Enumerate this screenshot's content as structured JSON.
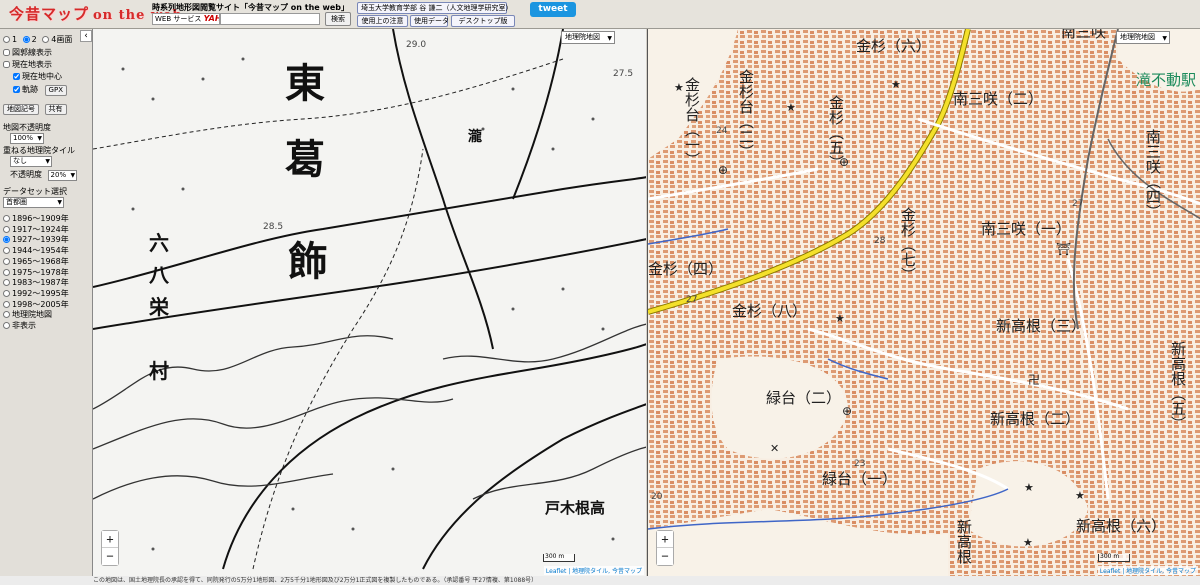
{
  "header": {
    "logo_main": "今昔マップ",
    "logo_sub": "on the web",
    "site_title": "時系列地形図閲覧サイト「今昔マップ on the web」",
    "search_badge_prefix": "WEB サービス",
    "search_badge_brand": "YAHOO!",
    "search_button": "検索",
    "author": "埼玉大学教育学部 谷 謙二（人文地理学研究室）",
    "notes_button": "使用上の注意",
    "data_button": "使用データ",
    "desktop_button": "デスクトップ版",
    "tweet_button": "tweet"
  },
  "sidebar": {
    "toggle": "‹",
    "screens": [
      "1",
      "2",
      "4画面"
    ],
    "screens_selected": 1,
    "boundary_label": "図郭線表示",
    "current_location_label": "現在地表示",
    "current_center_label": "現在地中心",
    "track_label": "軌跡",
    "gpx_button": "GPX",
    "map_symbols_button": "地図記号",
    "share_button": "共有",
    "opacity_label": "地図不透明度",
    "opacity_value": "100%",
    "overlay_label": "重ねる地理院タイル",
    "overlay_value": "なし",
    "overlay_opacity_label": "不透明度",
    "overlay_opacity_value": "20%",
    "dataset_label": "データセット選択",
    "dataset_value": "首都圏",
    "periods": [
      "1896～1909年",
      "1917～1924年",
      "1927～1939年",
      "1944～1954年",
      "1965～1968年",
      "1975～1978年",
      "1983～1987年",
      "1992～1995年",
      "1998～2005年",
      "地理院地図",
      "非表示"
    ],
    "period_selected": 2
  },
  "map_left": {
    "layer_select": "地理院地図",
    "labels": [
      "東",
      "葛",
      "飾",
      "六",
      "八",
      "栄",
      "村",
      "瀧",
      "戸木根高"
    ],
    "numbers": [
      "29.0",
      "27.5",
      "28.5"
    ],
    "scale": "300 m",
    "attribution": "Leaflet | 地理院タイル, 今昔マップ"
  },
  "map_right": {
    "layer_select": "地理院地図",
    "labels": {
      "kanasugi6": "金杉（六）",
      "kanasugidai1": "金杉台（一）",
      "kanasugidai2": "金杉台（二）",
      "kanasugi5": "金杉（五）",
      "kanasugi7": "金杉（七）",
      "kanasugi4": "金杉（四）",
      "kanasugi8": "金杉（八）",
      "minamisansaki2": "南三咲（二）",
      "minamisansaki1": "南三咲（一）",
      "minamisansaki4": "南三咲（四）",
      "minamisansaki_top": "南三咲",
      "takifudo": "滝不動駅",
      "shintakane3": "新高根（三）",
      "shintakane2": "新高根（二）",
      "shintakane5": "新高根（五）",
      "shintakane6": "新高根（六）",
      "shintakane_v": "新高根",
      "midoridai2": "緑台（二）",
      "midoridai1": "緑台（一）"
    },
    "numbers": [
      "24",
      "27",
      "28",
      "27",
      "23",
      "20"
    ],
    "scale": "300 m",
    "attribution": "Leaflet | 地理院タイル, 今昔マップ"
  },
  "footer": {
    "text": "この地図は、国土地理院長の承認を得て、同院発行の5万分1地形図、2万5千分1地形図及び2万分1正式図を複製したものである。（承認番号 平27情複、第1088号）"
  },
  "colors": {
    "logo": "#d62a2a",
    "tweet": "#1b95e0",
    "road_yellow": "#f4e02a",
    "building": "#d9916a"
  }
}
